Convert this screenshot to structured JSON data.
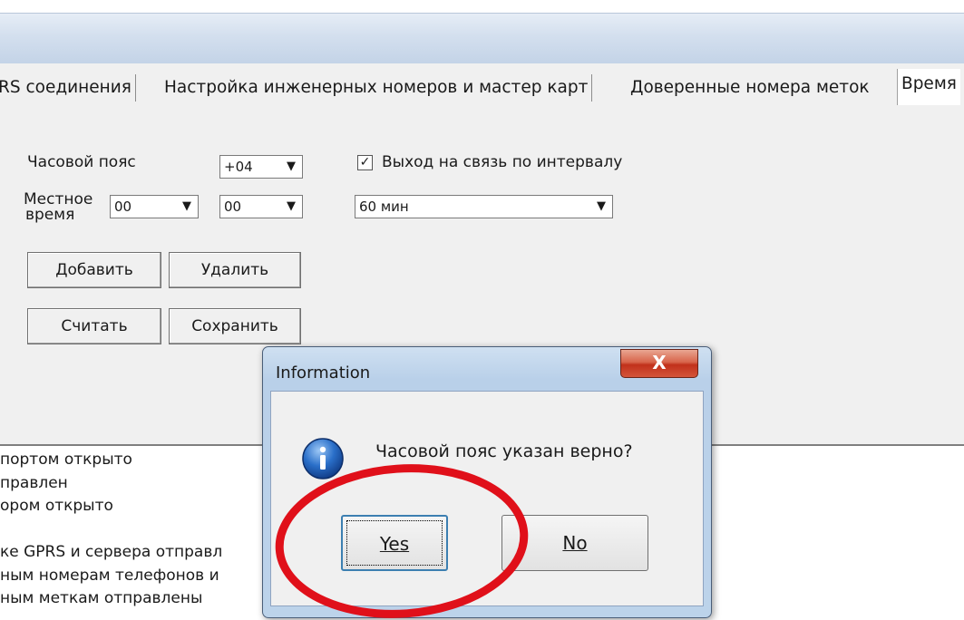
{
  "tabs": [
    {
      "label": "RS соединения"
    },
    {
      "label": "Настройка инженерных номеров и мастер карт"
    },
    {
      "label": "Доверенные номера меток"
    },
    {
      "label": "Время"
    }
  ],
  "form": {
    "timezone_label": "Часовой пояс",
    "timezone_value": "+04",
    "local_time_label_1": "Местное",
    "local_time_label_2": "время",
    "hours_value": "00",
    "minutes_value": "00",
    "interval_checkbox_label": "Выход на связь по интервалу",
    "interval_checked": true,
    "interval_value": "60 мин",
    "add_button": "Добавить",
    "delete_button": "Удалить",
    "read_button": "Считать",
    "save_button": "Сохранить"
  },
  "log": [
    "портом открыто",
    "правлен",
    "ором открыто",
    "",
    "ке GPRS и сервера отправл",
    "ным номерам телефонов и",
    "ным меткам отправлены"
  ],
  "dialog": {
    "title": "Information",
    "message": "Часовой пояс указан верно?",
    "yes_label": "Yes",
    "no_label": "No",
    "close_glyph": "X"
  },
  "colors": {
    "annotation_ellipse": "#e0101a",
    "info_icon": "#2a6fc9"
  }
}
